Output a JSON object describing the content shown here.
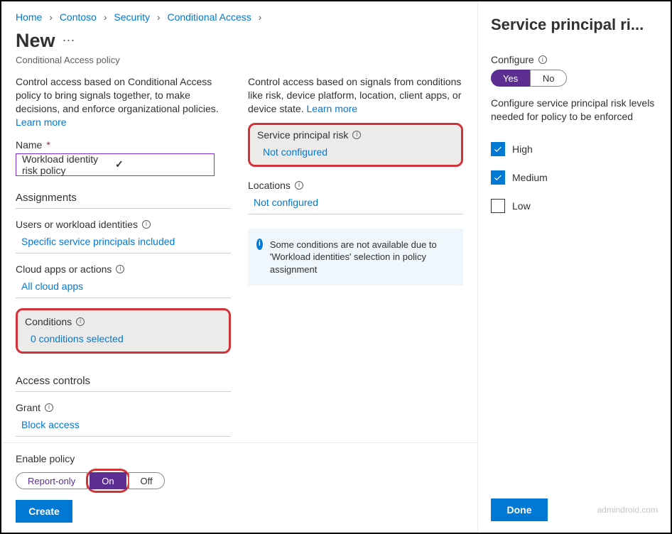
{
  "breadcrumb": {
    "items": [
      {
        "label": "Home"
      },
      {
        "label": "Contoso"
      },
      {
        "label": "Security"
      },
      {
        "label": "Conditional Access"
      }
    ]
  },
  "header": {
    "title": "New",
    "more": "⋯",
    "subtitle": "Conditional Access policy"
  },
  "left": {
    "intro": "Control access based on Conditional Access policy to bring signals together, to make decisions, and enforce organizational policies.",
    "learn_more": "Learn more",
    "name_label": "Name",
    "name_value": "Workload identity risk policy",
    "assignments_heading": "Assignments",
    "users_label": "Users or workload identities",
    "users_value": "Specific service principals included",
    "apps_label": "Cloud apps or actions",
    "apps_value": "All cloud apps",
    "conditions_label": "Conditions",
    "conditions_value": "0 conditions selected",
    "controls_heading": "Access controls",
    "grant_label": "Grant",
    "grant_value": "Block access"
  },
  "mid": {
    "intro": "Control access based on signals from conditions like risk, device platform, location, client apps, or device state.",
    "learn_more": "Learn more",
    "sp_risk_label": "Service principal risk",
    "sp_risk_value": "Not configured",
    "locations_label": "Locations",
    "locations_value": "Not configured",
    "infobar": "Some conditions are not available due to 'Workload identities' selection in policy assignment"
  },
  "footer": {
    "enable_label": "Enable policy",
    "report_only": "Report-only",
    "on": "On",
    "off": "Off",
    "create": "Create"
  },
  "panel": {
    "title": "Service principal ri...",
    "configure_label": "Configure",
    "toggle_yes": "Yes",
    "toggle_no": "No",
    "configure_desc": "Configure service principal risk levels needed for policy to be enforced",
    "opt_high": "High",
    "opt_medium": "Medium",
    "opt_low": "Low",
    "done": "Done"
  },
  "watermark": "admindroid.com"
}
